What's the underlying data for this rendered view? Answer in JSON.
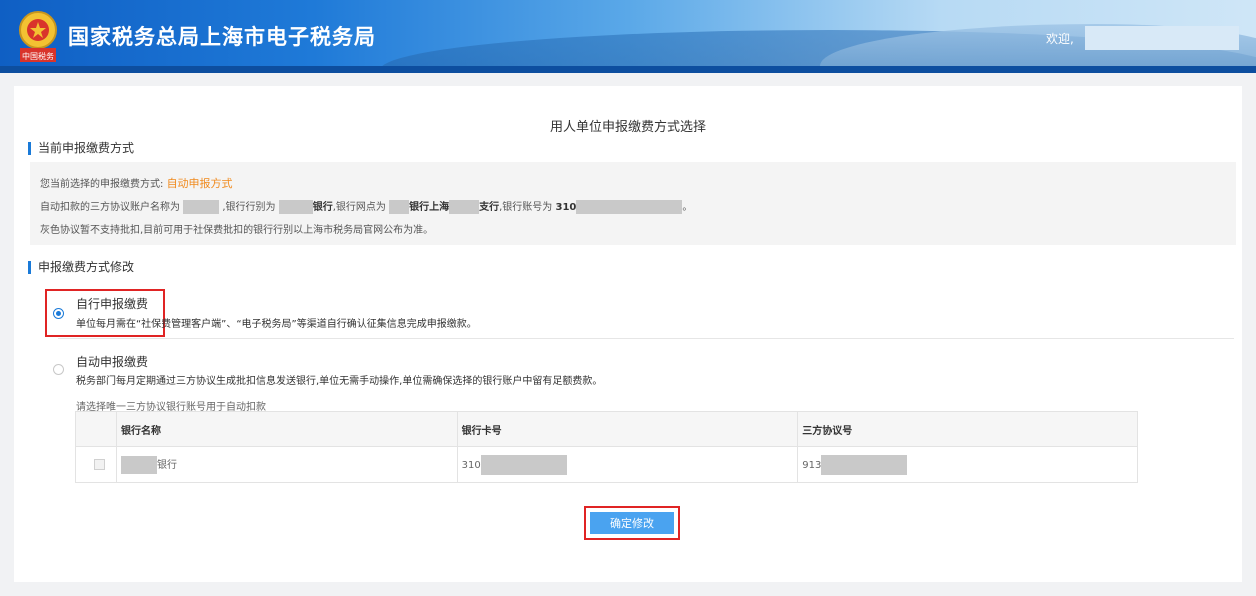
{
  "header": {
    "title": "国家税务总局上海市电子税务局",
    "welcome": "欢迎,",
    "emblem_text": "中国税务"
  },
  "page": {
    "title": "用人单位申报缴费方式选择"
  },
  "current": {
    "heading": "当前申报缴费方式",
    "line1_prefix": "您当前选择的申报缴费方式:",
    "line1_value": "自动申报方式",
    "line2_a": "自动扣款的三方协议账户名称为",
    "line2_b": ",银行行别为",
    "line2_c": "银行",
    "line2_d": ",银行网点为",
    "line2_e": "银行上海",
    "line2_f": "支行",
    "line2_g": ",银行账号为",
    "line2_h": "310",
    "line2_end": "。",
    "line3": "灰色协议暂不支持批扣,目前可用于社保费批扣的银行行别以上海市税务局官网公布为准。"
  },
  "modify": {
    "heading": "申报缴费方式修改",
    "option1_label": "自行申报缴费",
    "option1_desc": "单位每月需在“社保费管理客户端”、“电子税务局”等渠道自行确认征集信息完成申报缴款。",
    "option2_label": "自动申报缴费",
    "option2_desc": "税务部门每月定期通过三方协议生成批扣信息发送银行,单位无需手动操作,单位需确保选择的银行账户中留有足额费款。",
    "hint": "请选择唯一三方协议银行账号用于自动扣款"
  },
  "table": {
    "headers": [
      "银行名称",
      "银行卡号",
      "三方协议号"
    ],
    "row": {
      "bank_suffix": "银行",
      "card_prefix": "310",
      "agreement_prefix": "913"
    }
  },
  "confirm_button": "确定修改",
  "colors": {
    "accent": "#1a7ad8",
    "highlight": "#f08a1d",
    "annotation": "#e02424",
    "button": "#4aa3f0"
  }
}
